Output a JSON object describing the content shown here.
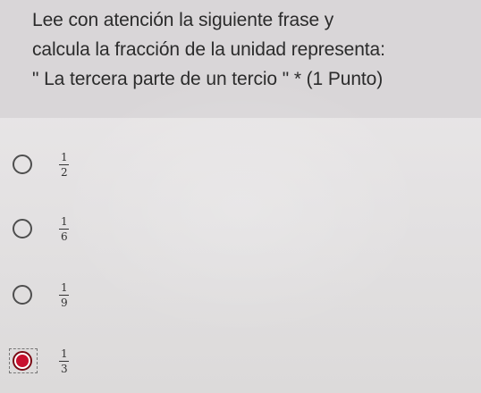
{
  "question": {
    "line1": "Lee con atención la siguiente frase y",
    "line2": "calcula la fracción de la unidad representa:",
    "line3": "\" La tercera parte de un tercio \" *  (1 Punto)"
  },
  "options": [
    {
      "numerator": "1",
      "denominator": "2",
      "selected": false
    },
    {
      "numerator": "1",
      "denominator": "6",
      "selected": false
    },
    {
      "numerator": "1",
      "denominator": "9",
      "selected": false
    },
    {
      "numerator": "1",
      "denominator": "3",
      "selected": true
    }
  ],
  "colors": {
    "selected_fill": "#c8102e",
    "selected_border": "#7a0a14",
    "text": "#2b2b2b"
  }
}
